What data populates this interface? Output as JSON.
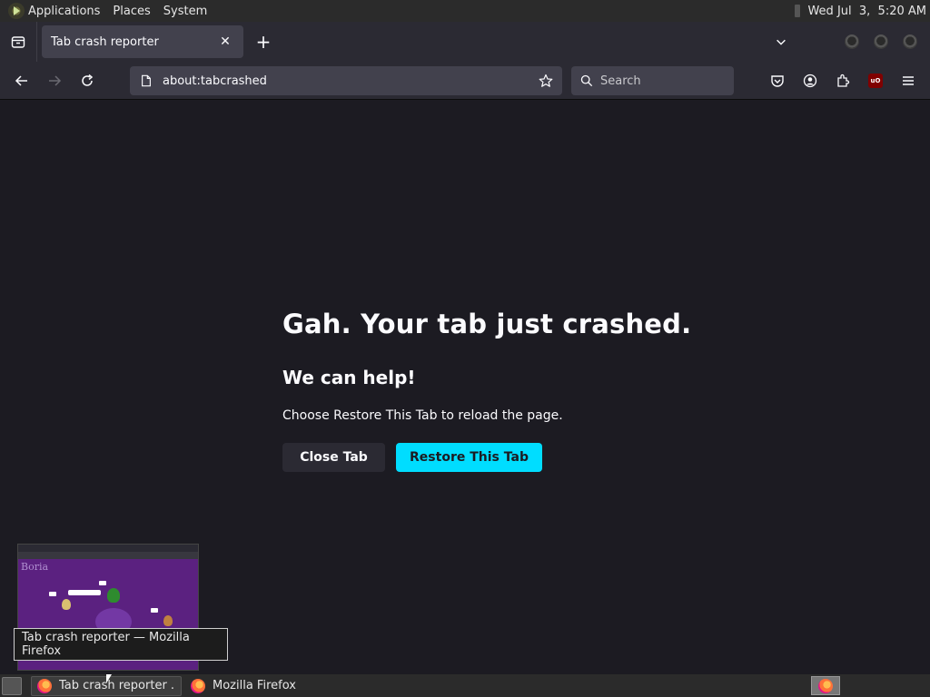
{
  "top_panel": {
    "menus": [
      "Applications",
      "Places",
      "System"
    ],
    "clock": "Wed Jul  3,  5:20 AM"
  },
  "browser": {
    "tab": {
      "title": "Tab crash reporter",
      "close_glyph": "✕"
    },
    "new_tab_glyph": "+",
    "url": "about:tabcrashed",
    "search_placeholder": "Search"
  },
  "toolbar_icons": [
    "back-arrow-icon",
    "forward-arrow-icon",
    "reload-icon",
    "page-icon",
    "bookmark-star-icon",
    "search-icon",
    "pocket-icon",
    "account-icon",
    "extensions-icon",
    "ublock-origin-icon",
    "hamburger-menu-icon"
  ],
  "ublock_badge": "uO",
  "crash_page": {
    "title": "Gah. Your tab just crashed.",
    "subtitle": "We can help!",
    "message": "Choose Restore This Tab to reload the page.",
    "close_button": "Close Tab",
    "restore_button": "Restore This Tab"
  },
  "preview": {
    "thumb_title": "Boria",
    "tooltip": "Tab crash reporter — Mozilla Firefox"
  },
  "taskbar": {
    "items": [
      {
        "label": "Tab crash reporter ...",
        "active": true
      },
      {
        "label": "Mozilla Firefox",
        "active": false
      }
    ]
  },
  "colors": {
    "content_bg": "#1c1b22",
    "toolbar_bg": "#2b2a33",
    "field_bg": "#42414d",
    "accent": "#00ddff"
  }
}
